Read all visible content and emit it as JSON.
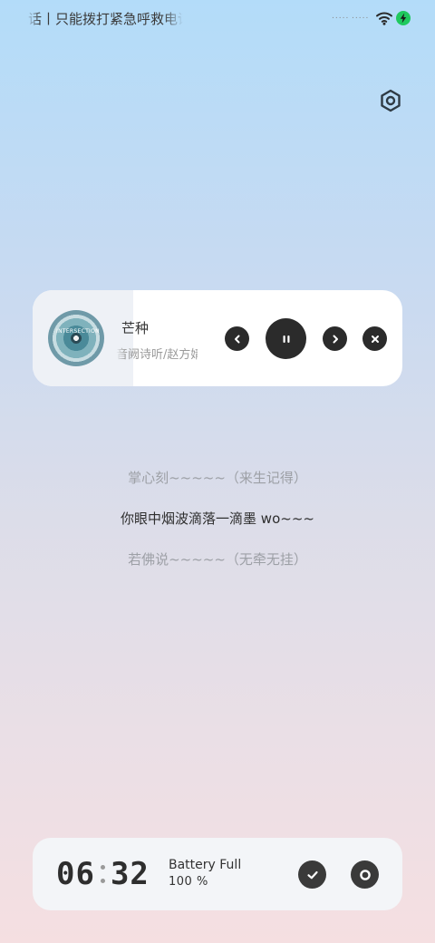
{
  "status_bar": {
    "carrier_text": "电话丨只能拨打紧急呼救电话",
    "signal_1": "..... ",
    "signal_2": ".....",
    "wifi_icon": "wifi-icon",
    "battery_icon": "charging-bolt-icon",
    "battery_color": "#1fc95e"
  },
  "settings": {
    "icon": "hexagon-settings-icon"
  },
  "music_card": {
    "album_art_text": "INTERSECTION",
    "song_title": "芒种",
    "artist": "音阙诗听/赵方婧",
    "controls": [
      "previous-icon",
      "pause-icon",
      "next-icon",
      "close-icon"
    ]
  },
  "lyrics": {
    "previous": "掌心刻~~~~~（来生记得）",
    "current": "你眼中烟波滴落一滴墨 wo~~~",
    "next": "若佛说~~~~~（无牵无挂）"
  },
  "bottom_widget": {
    "clock_hours": "06",
    "clock_minutes": "32",
    "battery_label": "Battery Full",
    "battery_percent": "100 %",
    "buttons": [
      "check-icon",
      "record-icon"
    ]
  },
  "colors": {
    "button_dark": "#2b2b2b",
    "lyric_current": "#2e2e2e",
    "lyric_dim": "#9da0a6"
  }
}
